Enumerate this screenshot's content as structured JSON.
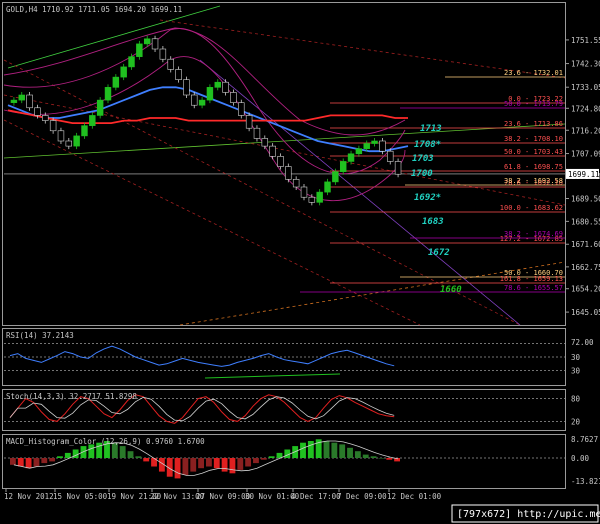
{
  "chart_data": {
    "type": "line",
    "title": "GOLD,H4  1710.92 1711.05 1694.20 1699.11",
    "symbol": "GOLD",
    "timeframe": "H4",
    "ohlc": {
      "open": 1710.92,
      "high": 1711.05,
      "low": 1694.2,
      "close": 1699.11
    },
    "last_price": 1699.11,
    "price_ylim": [
      1640,
      1766
    ],
    "price_ticks": [
      1751.55,
      1742.3,
      1733.05,
      1724.8,
      1716.2,
      1707.09,
      1698.4,
      1689.5,
      1680.55,
      1671.6,
      1662.75,
      1654.2,
      1645.05
    ],
    "x_labels": [
      "12 Nov 2012",
      "15 Nov 05:00",
      "19 Nov 21:00",
      "22 Nov 13:00",
      "27 Nov 09:00",
      "30 Nov 01:00",
      "4 Dec 17:00",
      "7 Dec 09:00",
      "12 Dec 01:00"
    ],
    "series": [
      {
        "name": "",
        "color": "#3f7fff",
        "values": [
          1726,
          1724,
          1722,
          1721,
          1721,
          1722,
          1723,
          1724,
          1726,
          1728,
          1730,
          1732,
          1733,
          1733,
          1732,
          1730,
          1728,
          1726,
          1724,
          1722,
          1720,
          1718,
          1716,
          1714,
          1712,
          1711,
          1710,
          1709,
          1708,
          1708,
          1709,
          1710
        ]
      },
      {
        "name": "",
        "color": "#ff2a2a",
        "values": [
          1724,
          1723,
          1722,
          1721,
          1720,
          1719,
          1719,
          1719,
          1719,
          1720,
          1720,
          1721,
          1721,
          1721,
          1720,
          1720,
          1720,
          1720,
          1720,
          1720,
          1720,
          1720,
          1720,
          1720,
          1721,
          1722,
          1722,
          1722,
          1722,
          1722,
          1721,
          1721
        ]
      }
    ],
    "fibonacci_levels": [
      {
        "label": "23.6 - 1732.01",
        "color": "#ffd080"
      },
      {
        "label": "0.0 - 1723.22",
        "color": "#ff5050"
      },
      {
        "label": "23.6 - 1713.86",
        "color": "#ff5050"
      },
      {
        "label": "38.2 - 1708.10",
        "color": "#ff5050"
      },
      {
        "label": "50.0 - 1703.43",
        "color": "#ff5050"
      },
      {
        "label": "61.8 - 1698.75",
        "color": "#ff5050"
      },
      {
        "label": "78.6 - 1692.10",
        "color": "#ff5050"
      },
      {
        "label": "38.2 - 1692.58",
        "color": "#ffd080"
      },
      {
        "label": "100.0 - 1683.62",
        "color": "#ff5050"
      },
      {
        "label": "127.2 - 1672.85",
        "color": "#ff5050"
      },
      {
        "label": "50.0 - 1660.70",
        "color": "#ffd080"
      },
      {
        "label": "161.8 - 1659.13",
        "color": "#ff5050"
      },
      {
        "label": "78.6 - 1655.57",
        "color": "#b000b0"
      },
      {
        "label": "38.2 - 1674.69",
        "color": "#b000b0"
      },
      {
        "label": "50.0 - 1713.79",
        "color": "#b000b0"
      }
    ],
    "level_labels": [
      "1713",
      "1708*",
      "1703",
      "1700",
      "1692*",
      "1683",
      "1672",
      "1660"
    ],
    "rsi": {
      "label": "RSI(14) 37.2143",
      "levels": [
        70,
        50,
        30
      ],
      "ticks": [
        "72.00",
        "30",
        "30"
      ]
    },
    "stoch": {
      "label": "Stoch(14,3,3) 32.2717 51.8298",
      "ticks": [
        "80",
        "20"
      ]
    },
    "macd": {
      "label": "MACD_Histogram_Color (12,26,9)  0.9760 1.6700",
      "ticks": [
        "8.7627",
        "0.00",
        "-13.8214"
      ]
    },
    "watermark": "[797x672] http://upic.me/"
  }
}
